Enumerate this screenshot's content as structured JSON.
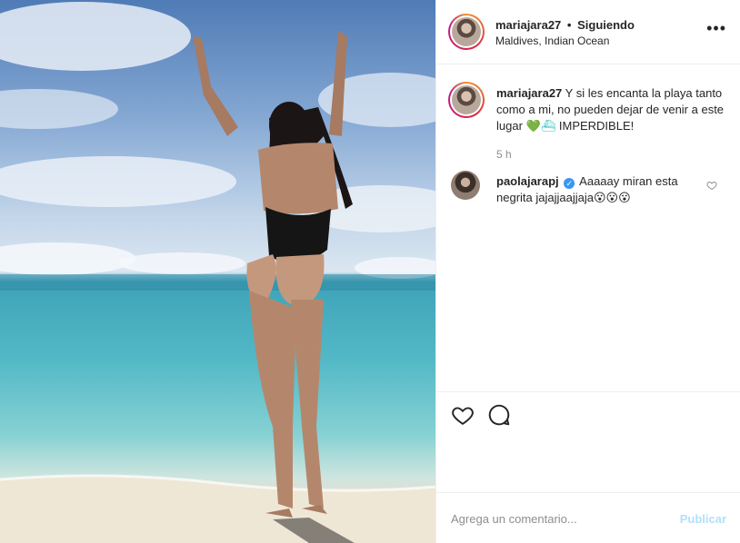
{
  "post": {
    "username": "mariajara27",
    "separator": "•",
    "follow_status": "Siguiendo",
    "location": "Maldives, Indian Ocean"
  },
  "caption": {
    "username": "mariajara27",
    "text": "Y si les encanta la playa tanto como a mi, no pueden dejar de venir a este lugar",
    "emoji": "💚⛴",
    "suffix": "IMPERDIBLE!",
    "time": "5 h"
  },
  "comments": [
    {
      "username": "paolajarapj",
      "verified": true,
      "text": "Aaaaay miran esta negrita jajajjaajjaja",
      "emoji": "😮😮😮"
    }
  ],
  "add_comment": {
    "placeholder": "Agrega un comentario...",
    "publish_label": "Publicar"
  },
  "icons": {
    "more": "more-options-icon",
    "like": "heart-icon",
    "comment": "comment-bubble-icon",
    "verified": "verified-badge-icon"
  },
  "colors": {
    "accent_link": "#3897f0",
    "publish_disabled": "#b2dffc",
    "secondary_text": "#8e8e8e"
  }
}
